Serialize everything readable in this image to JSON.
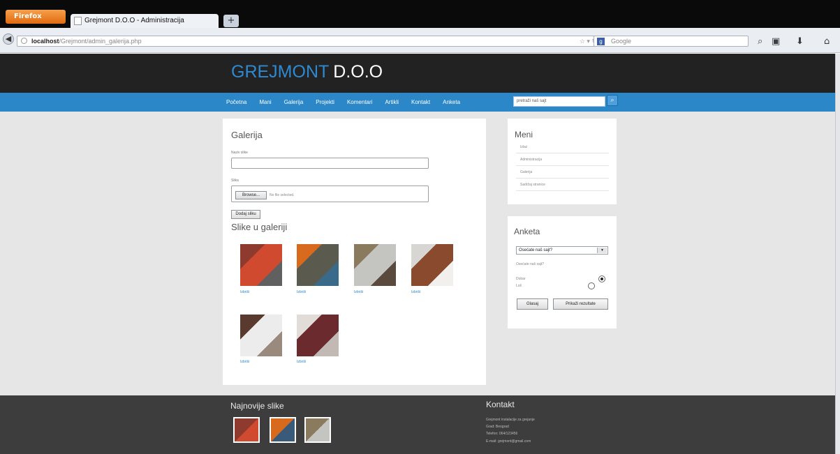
{
  "browser": {
    "app_button": "Firefox",
    "tab_title": "Grejmont D.O.O - Administracija",
    "new_tab": "+",
    "url_host": "localhost",
    "url_path": "/Grejmont/admin_galerija.php",
    "search_engine_placeholder": "Google"
  },
  "site": {
    "logo_part1": "GREJMONT",
    "logo_part2": "D.O.O",
    "nav": [
      "Početna",
      "Mani",
      "Galerija",
      "Projekti",
      "Komentari",
      "Artikli",
      "Kontakt",
      "Anketa"
    ],
    "search_placeholder": "pretraži naš sajt"
  },
  "main": {
    "title": "Galerija",
    "name_label": "Naziv slike",
    "file_label": "Slika",
    "browse_label": "Browse...",
    "no_file": "No file selected.",
    "add_button": "Dodaj sliku",
    "gallery_title": "Slike u galeriji",
    "images": [
      {
        "link": "Izbriši",
        "colors": [
          "#8e3a2e",
          "#cf4a2e",
          "#606060"
        ]
      },
      {
        "link": "Izbriši",
        "colors": [
          "#d86a1e",
          "#5a5a4e",
          "#3a6a8a"
        ]
      },
      {
        "link": "Izbriši",
        "colors": [
          "#8a7a5e",
          "#c4c4c0",
          "#5a4a3e"
        ]
      },
      {
        "link": "Izbriši",
        "colors": [
          "#d8d6d2",
          "#8a4a2e",
          "#f2f0ec"
        ]
      },
      {
        "link": "Izbriši",
        "colors": [
          "#5a3a2e",
          "#ececec",
          "#9a8a7e"
        ]
      },
      {
        "link": "Izbriši",
        "colors": [
          "#e2dcd8",
          "#6a2a2e",
          "#c2b8b4"
        ]
      }
    ]
  },
  "sidebar": {
    "menu_title": "Meni",
    "menu_items": [
      "Izlaz",
      "Administracija",
      "Galerija",
      "Sadržaj stranice"
    ],
    "poll_title": "Anketa",
    "poll_select": "Osećate naš sajt?",
    "poll_question": "Osećate naš sajt?",
    "poll_answers": [
      "Dobar",
      "Loš"
    ],
    "vote_button": "Glasaj",
    "results_button": "Prikaži rezultate"
  },
  "footer": {
    "latest_title": "Najnovije slike",
    "contact_title": "Kontakt",
    "contact_lines": [
      "Grejmont instalacije za grejanje",
      "Grad: Beograd",
      "Telefon: 064/123456",
      "E-mail: grejmont@gmail.com"
    ],
    "thumbs": [
      {
        "colors": [
          "#8e3a2e",
          "#cf4a2e"
        ]
      },
      {
        "colors": [
          "#d86a1e",
          "#3a5a7a"
        ]
      },
      {
        "colors": [
          "#8a7a5e",
          "#c4c4c0"
        ]
      }
    ]
  }
}
